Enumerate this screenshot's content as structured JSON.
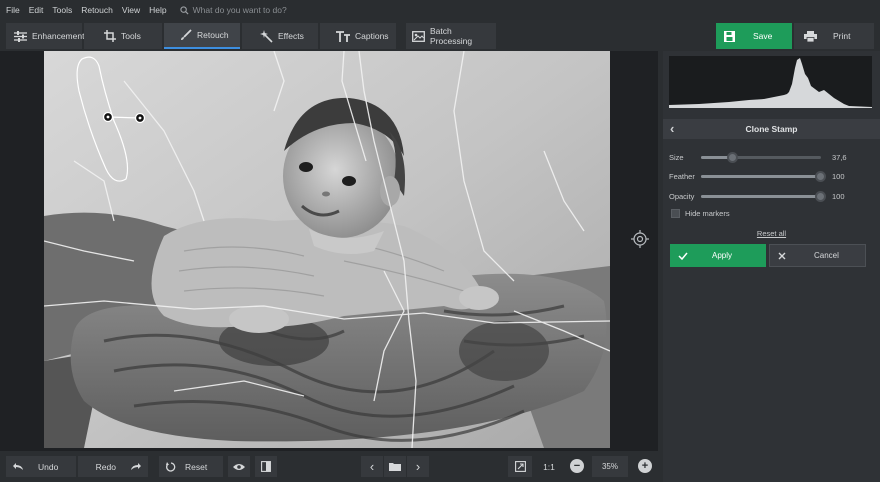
{
  "menu": {
    "items": [
      "File",
      "Edit",
      "Tools",
      "Retouch",
      "View",
      "Help"
    ],
    "search_placeholder": "What do you want to do?"
  },
  "toolbar": {
    "tabs": [
      {
        "label": "Enhancement",
        "icon": "sliders-icon"
      },
      {
        "label": "Tools",
        "icon": "crop-icon"
      },
      {
        "label": "Retouch",
        "icon": "brush-icon",
        "active": true
      },
      {
        "label": "Effects",
        "icon": "magic-wand-icon"
      },
      {
        "label": "Captions",
        "icon": "text-icon"
      }
    ],
    "batch_label": "Batch Processing",
    "save_label": "Save",
    "print_label": "Print"
  },
  "panel": {
    "title": "Clone Stamp",
    "sliders": [
      {
        "label": "Size",
        "value": "37,6",
        "fraction": 0.27
      },
      {
        "label": "Feather",
        "value": "100",
        "fraction": 1.0
      },
      {
        "label": "Opacity",
        "value": "100",
        "fraction": 1.0
      }
    ],
    "hide_markers_label": "Hide markers",
    "hide_markers_checked": false,
    "reset_all_label": "Reset all",
    "apply_label": "Apply",
    "cancel_label": "Cancel"
  },
  "bottom": {
    "undo_label": "Undo",
    "redo_label": "Redo",
    "reset_label": "Reset",
    "ratio_label": "1:1",
    "zoom_value": "35%"
  },
  "colors": {
    "accent_green": "#1e9c5a",
    "active_tab_underline": "#3d8fe0",
    "background": "#2b2e31"
  }
}
